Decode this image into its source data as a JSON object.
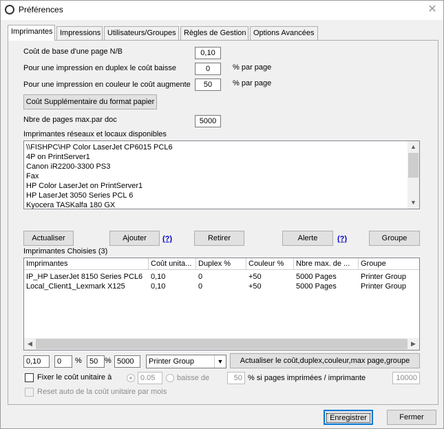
{
  "window": {
    "title": "Préférences"
  },
  "tabs": [
    "Imprimantes",
    "Impressions",
    "Utilisateurs/Groupes",
    "Règles de Gestion",
    "Options Avancées"
  ],
  "cost": {
    "base_label": "Coût de base d'une page N/B",
    "base_value": "0,10",
    "duplex_label": "Pour une impression en duplex le coût baisse",
    "duplex_value": "0",
    "duplex_unit": "% par page",
    "color_label": "Pour une impression en couleur le coût augmente",
    "color_value": "50",
    "color_unit": "% par page",
    "format_button": "Coût Supplémentaire du format papier",
    "maxpages_label": "Nbre de pages max.par doc",
    "maxpages_value": "5000"
  },
  "available": {
    "label": "Imprimantes réseaux et locaux disponibles",
    "items": [
      "\\\\FISHPC\\HP Color LaserJet CP6015 PCL6",
      "4P on PrintServer1",
      "Canon iR2200-3300 PS3",
      "Fax",
      "HP Color LaserJet on PrintServer1",
      "HP LaserJet 3050 Series PCL 6",
      "Kyocera TASKalfa 180 GX"
    ]
  },
  "buttons": {
    "refresh": "Actualiser",
    "add": "Ajouter",
    "help1": "(?)",
    "remove": "Retirer",
    "alert": "Alerte",
    "help2": "(?)",
    "group": "Groupe"
  },
  "chosen": {
    "label": "Imprimantes Choisies (3)",
    "columns": [
      "Imprimantes",
      "Coût unita...",
      "Duplex %",
      "Couleur %",
      "Nbre max. de ...",
      "Groupe"
    ],
    "rows": [
      [
        "IP_HP LaserJet 8150 Series PCL6",
        "0,10",
        "0",
        "+50",
        "5000 Pages",
        "Printer Group"
      ],
      [
        "Local_Client1_Lexmark X125",
        "0,10",
        "0",
        "+50",
        "5000 Pages",
        "Printer Group"
      ]
    ]
  },
  "edit": {
    "cost": "0,10",
    "duplex": "0",
    "pct1": "%",
    "color": "50",
    "pct2": "%",
    "maxpages": "5000",
    "group_select": "Printer Group",
    "update_button": "Actualiser le coût,duplex,couleur,max page,groupe"
  },
  "fix": {
    "checkbox_label": "Fixer le coût unitaire à",
    "value": "0.05",
    "radio_label": "baisse de",
    "percent": "50",
    "suffix": "% si pages imprimées / imprimante",
    "threshold": "10000",
    "reset_label": "Reset auto de la coût unitaire par mois"
  },
  "footer": {
    "save": "Enregistrer",
    "close": "Fermer"
  },
  "icons": {
    "close": "close-icon",
    "app": "app-icon"
  }
}
